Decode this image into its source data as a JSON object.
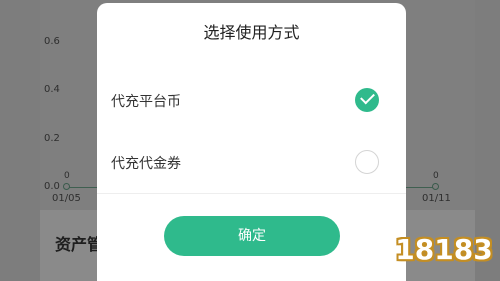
{
  "background": {
    "chart": {
      "y_ticks": [
        "0.6",
        "0.4",
        "0.2",
        "0.0"
      ],
      "x_ticks": [
        "01/05",
        "01/11"
      ],
      "point_labels": [
        "0",
        "0"
      ]
    },
    "section_title": "资产管"
  },
  "dialog": {
    "title": "选择使用方式",
    "options": [
      {
        "label": "代充平台币",
        "selected": true
      },
      {
        "label": "代充代金券",
        "selected": false
      }
    ],
    "confirm_label": "确定"
  },
  "watermark": {
    "text": "18183"
  },
  "colors": {
    "accent": "#2fba8c",
    "overlay": "#7d7d7d"
  }
}
